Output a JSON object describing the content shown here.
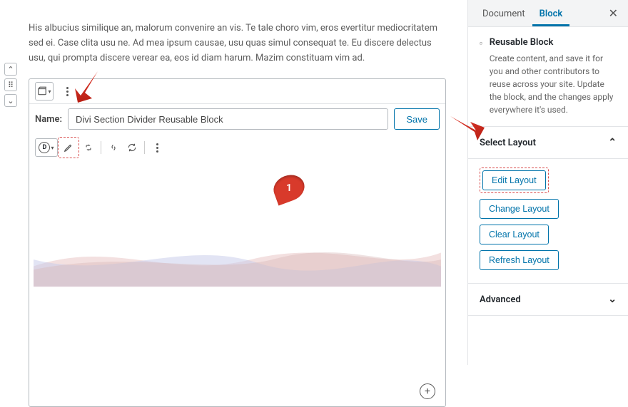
{
  "editor": {
    "lorem": "His albucius similique an, malorum convenire an vis. Te tale choro vim, eros evertitur mediocritatem sed ei. Case clita usu ne. Ad mea ipsum causae, usu quas simul consequat te. Eu discere delectus usu, qui prompta discere verear ea, eos id diam harum. Mazim constituam vim ad.",
    "name_label": "Name:",
    "name_value": "Divi Section Divider Reusable Block",
    "save_label": "Save",
    "callout_number": "1"
  },
  "sidebar": {
    "tabs": {
      "document": "Document",
      "block": "Block"
    },
    "panel": {
      "title": "Reusable Block",
      "desc": "Create content, and save it for you and other contributors to reuse across your site. Update the block, and the changes apply everywhere it's used."
    },
    "select_layout": {
      "title": "Select Layout",
      "edit": "Edit Layout",
      "change": "Change Layout",
      "clear": "Clear Layout",
      "refresh": "Refresh Layout"
    },
    "advanced": {
      "title": "Advanced"
    }
  }
}
